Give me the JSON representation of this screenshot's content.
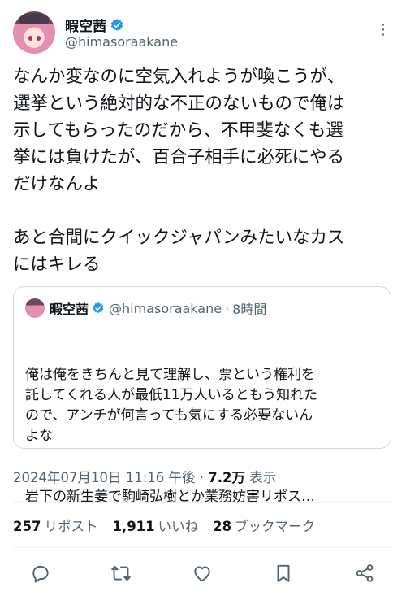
{
  "author": {
    "name": "暇空茜",
    "handle": "@himasoraakane",
    "avatar_icon": "anime-avatar"
  },
  "tweet": {
    "text": "なんか変なのに空気入れようが喚こうが、\n選挙という絶対的な不正のないもので俺は\n示してもらったのだから、不甲斐なくも選\n挙には負けたが、百合子相手に必死にやる\nだけなんよ\n\nあと合間にクイックジャパンみたいなカス\nにはキレる"
  },
  "quote": {
    "name": "暇空茜",
    "handle": "@himasoraakane",
    "separator": "·",
    "time": "8時間",
    "text": "俺は俺をきちんと見て理解し、票という権利を\n託してくれる人が最低11万人いるともう知れた\nので、アンチが何言っても気にする必要ないん\nよな",
    "last_line": "岩下の新生姜で駒崎弘樹とか業務妨害リポス…"
  },
  "meta": {
    "datetime": "2024年07月10日 11:16 午後",
    "dot": "·",
    "views": "7.2万",
    "views_label": "表示"
  },
  "stats": {
    "reposts": "257",
    "reposts_label": "リポスト",
    "likes": "1,911",
    "likes_label": "いいね",
    "bookmarks": "28",
    "bookmarks_label": "ブックマーク"
  },
  "colors": {
    "verified": "#1d9bf0",
    "secondary_text": "#536471",
    "border": "#cfd9de",
    "icon": "#536471"
  },
  "actions": [
    "reply-icon",
    "repost-icon",
    "like-icon",
    "bookmark-icon",
    "share-icon"
  ]
}
